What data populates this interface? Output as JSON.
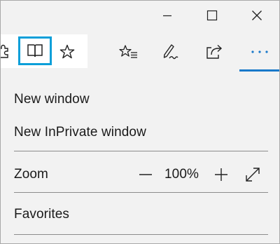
{
  "window": {
    "minimize_icon": "minimize-icon",
    "maximize_icon": "maximize-icon",
    "close_icon": "close-icon"
  },
  "toolbar": {
    "icons": [
      "extensions-icon",
      "reading-view-icon",
      "favorites-star-icon",
      "hub-icon",
      "web-note-icon",
      "share-icon",
      "more-icon"
    ],
    "accent_color": "#0c9fd9",
    "more_underline_color": "#1979ca"
  },
  "menu": {
    "new_window": "New window",
    "new_inprivate": "New InPrivate window",
    "zoom_label": "Zoom",
    "zoom_minus": "—",
    "zoom_value": "100%",
    "zoom_plus": "+",
    "favorites": "Favorites"
  }
}
